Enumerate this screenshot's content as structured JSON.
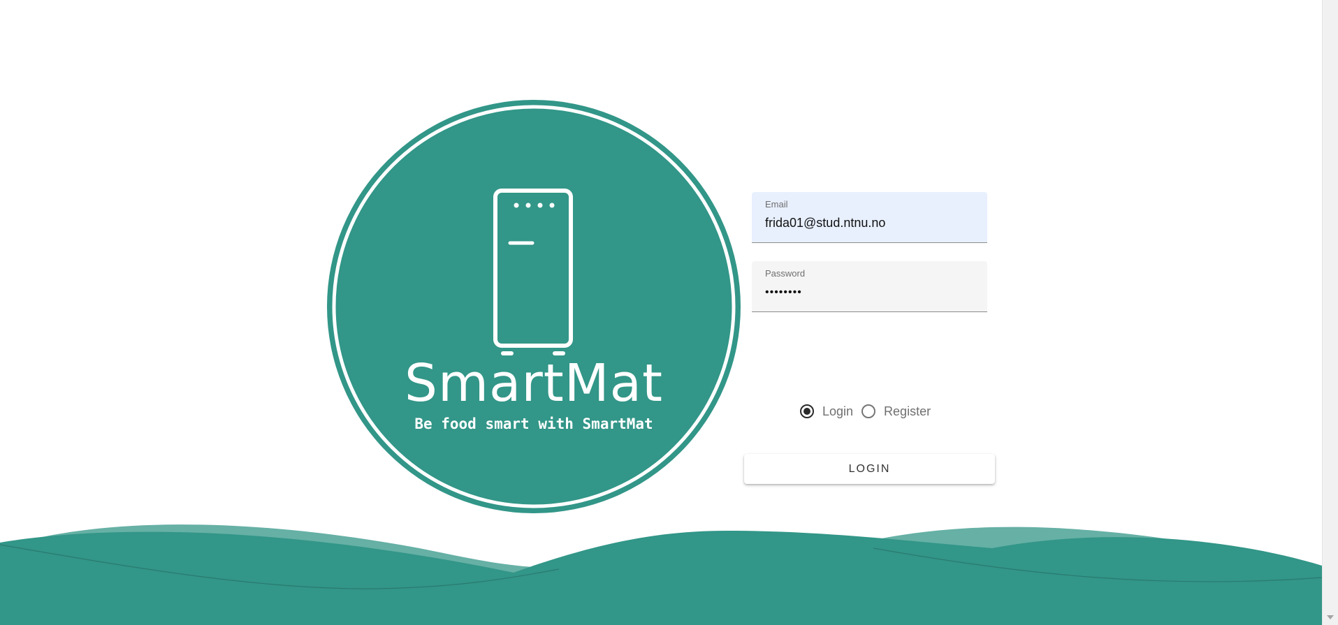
{
  "brand": {
    "name": "SmartMat",
    "tagline": "Be food smart with SmartMat",
    "logo_icon": "fridge-icon",
    "primary_color": "#329688",
    "light_wave_color": "#66b0a5"
  },
  "form": {
    "email": {
      "label": "Email",
      "value": "frida01@stud.ntnu.no"
    },
    "password": {
      "label": "Password",
      "value": "••••••••"
    },
    "mode_options": [
      {
        "label": "Login",
        "checked": true
      },
      {
        "label": "Register",
        "checked": false
      }
    ],
    "submit_label": "LOGIN"
  }
}
